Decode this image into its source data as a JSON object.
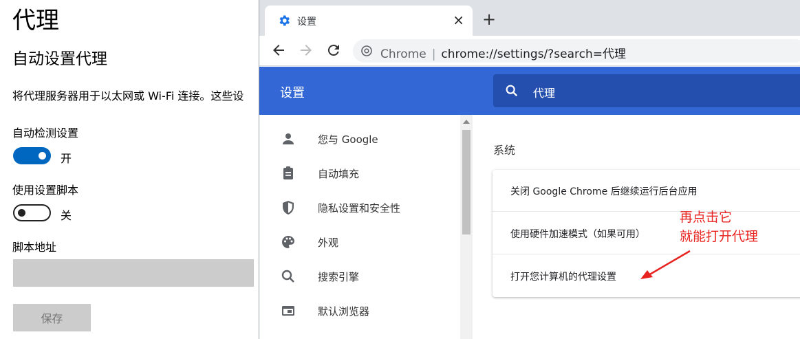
{
  "windows_settings": {
    "page_title": "代理",
    "section_title": "自动设置代理",
    "description": "将代理服务器用于以太网或 Wi-Fi 连接。这些设",
    "auto_detect": {
      "label": "自动检测设置",
      "state": "开"
    },
    "setup_script": {
      "label": "使用设置脚本",
      "state": "关"
    },
    "script_address": {
      "label": "脚本地址",
      "value": ""
    },
    "save_label": "保存"
  },
  "chrome": {
    "tab": {
      "title": "设置",
      "icon": "gear-icon"
    },
    "new_tab_label": "+",
    "close_tab_label": "×",
    "omnibox": {
      "site_name": "Chrome",
      "separator": "|",
      "url": "chrome://settings/?search=代理"
    },
    "settings_header": {
      "title": "设置",
      "search_query": "代理"
    },
    "sidebar": {
      "items": [
        {
          "label": "您与 Google",
          "icon": "person-icon"
        },
        {
          "label": "自动填充",
          "icon": "clipboard-icon"
        },
        {
          "label": "隐私设置和安全性",
          "icon": "shield-icon"
        },
        {
          "label": "外观",
          "icon": "palette-icon"
        },
        {
          "label": "搜索引擎",
          "icon": "search-icon"
        },
        {
          "label": "默认浏览器",
          "icon": "browser-icon"
        }
      ]
    },
    "content": {
      "section_title": "系统",
      "rows": [
        {
          "label": "关闭 Google Chrome 后继续运行后台应用"
        },
        {
          "label": "使用硬件加速模式（如果可用）"
        },
        {
          "label": "打开您计算机的代理设置"
        }
      ]
    }
  },
  "annotation": {
    "line1": "再点击它",
    "line2": "就能打开代理",
    "color": "#e8231f"
  },
  "colors": {
    "header_blue": "#3367d6",
    "search_blue": "#254fae",
    "toggle_blue": "#0067c0"
  }
}
